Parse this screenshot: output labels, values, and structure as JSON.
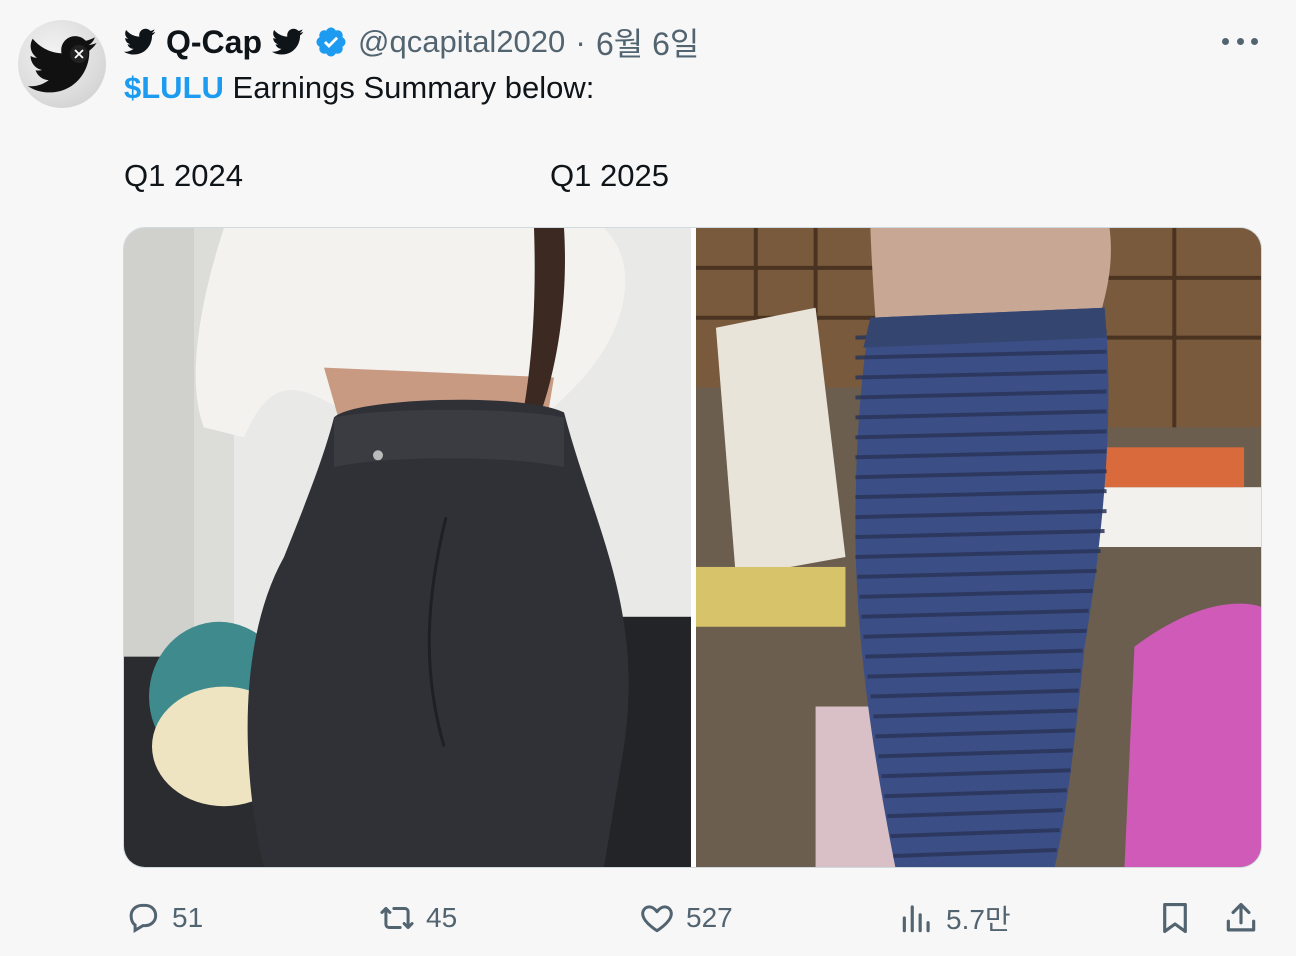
{
  "author": {
    "display_name": "Q-Cap",
    "handle": "@qcapital2020",
    "separator": "·",
    "date": "6월 6일"
  },
  "tweet": {
    "cashtag": "$LULU",
    "text": "Earnings Summary below:",
    "label_left": "Q1 2024",
    "label_right": "Q1 2025"
  },
  "actions": {
    "replies": "51",
    "retweets": "45",
    "likes": "527",
    "views": "5.7만"
  },
  "colors": {
    "accent": "#1d9bf0",
    "muted": "#536471",
    "text": "#0f1419"
  },
  "icons": [
    "bird-icon",
    "verified-badge-icon",
    "more-icon",
    "reply-icon",
    "retweet-icon",
    "like-icon",
    "views-icon",
    "bookmark-icon",
    "share-icon"
  ]
}
